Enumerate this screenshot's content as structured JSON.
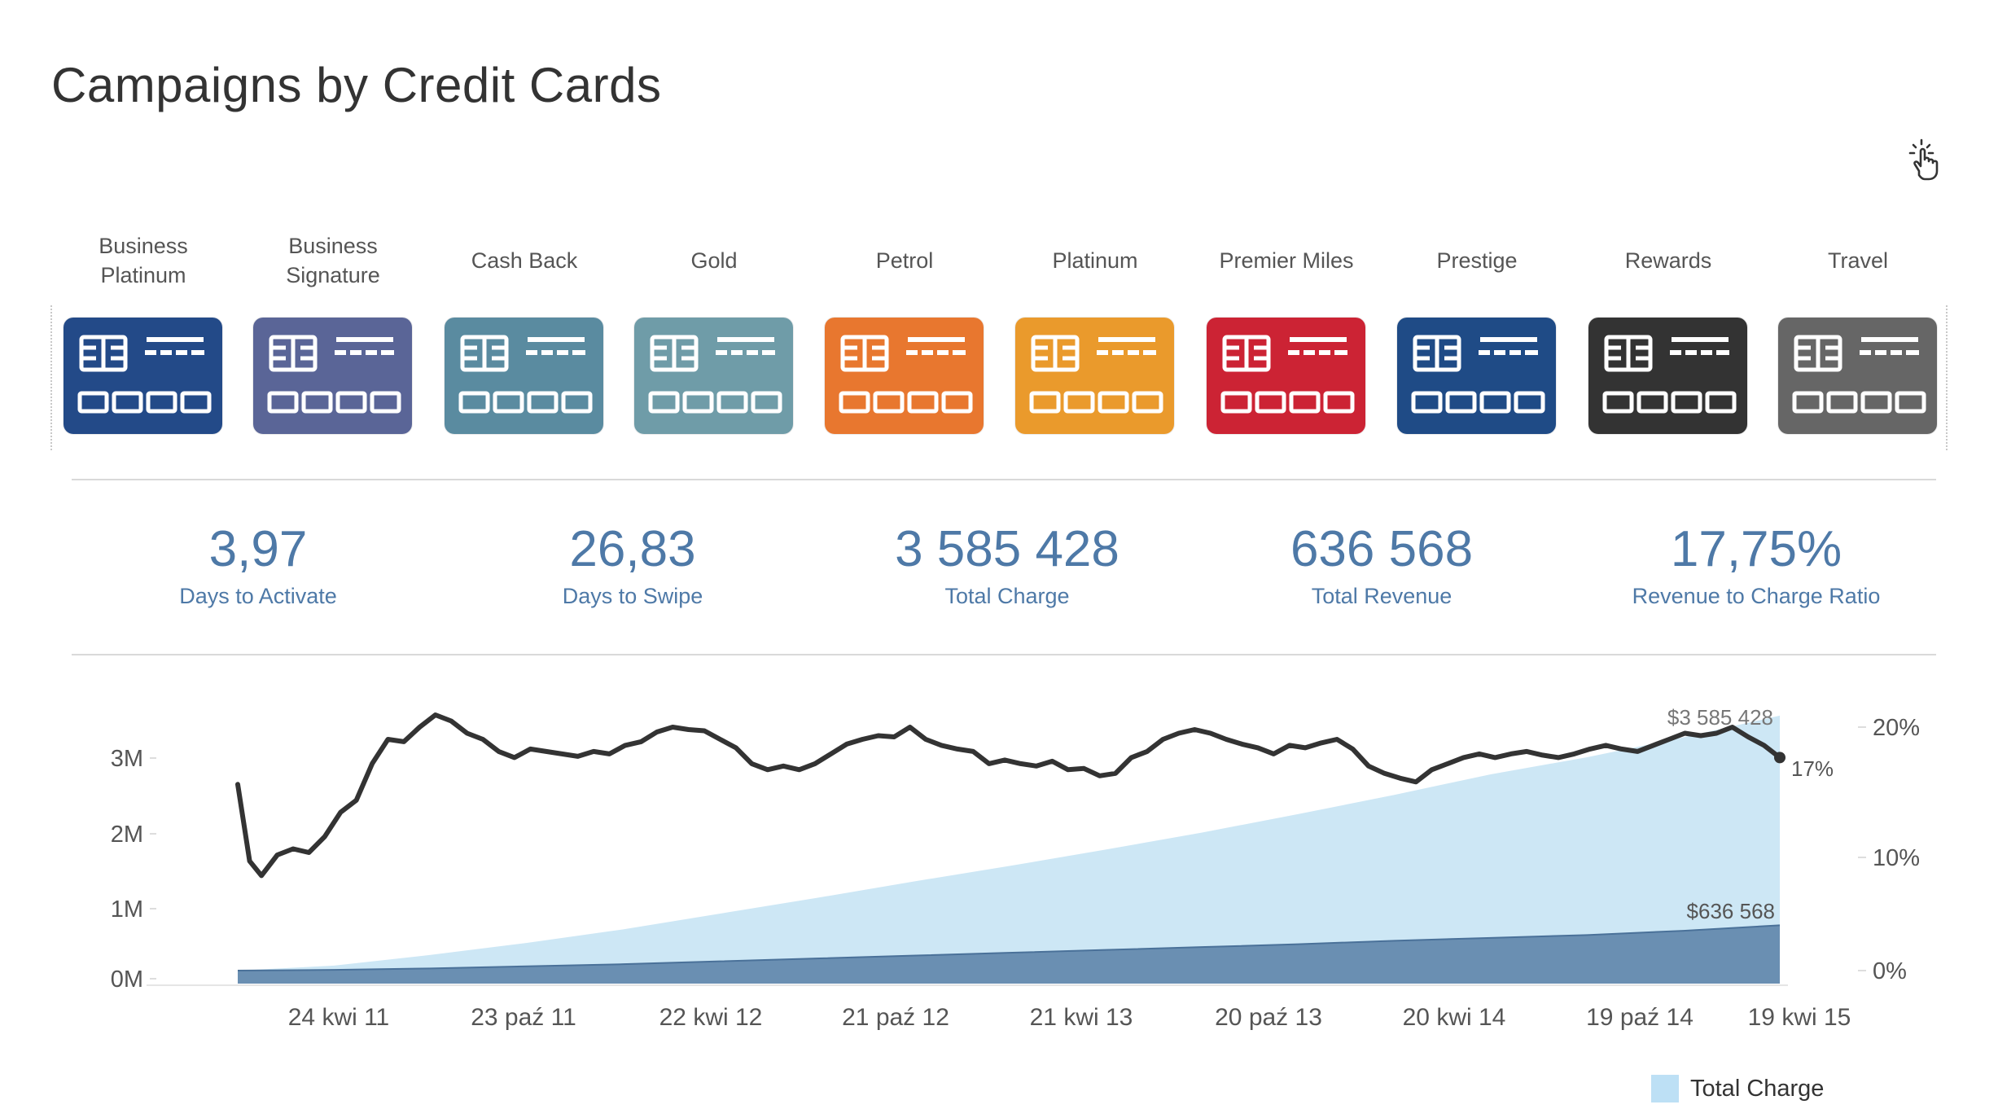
{
  "header": {
    "title": "Campaigns by Credit Cards"
  },
  "toolbar": {
    "touch_icon": "touch-gesture-icon"
  },
  "cards": [
    {
      "label": "Business\nPlatinum",
      "color": "#234a88"
    },
    {
      "label": "Business\nSignature",
      "color": "#5a6597"
    },
    {
      "label": "Cash Back",
      "color": "#5a8ba0"
    },
    {
      "label": "Gold",
      "color": "#6f9ca8"
    },
    {
      "label": "Petrol",
      "color": "#e8772f"
    },
    {
      "label": "Platinum",
      "color": "#ea9a2c"
    },
    {
      "label": "Premier Miles",
      "color": "#cc2334"
    },
    {
      "label": "Prestige",
      "color": "#1f4b86"
    },
    {
      "label": "Rewards",
      "color": "#333333"
    },
    {
      "label": "Travel",
      "color": "#666666"
    }
  ],
  "kpis": [
    {
      "value": "3,97",
      "label": "Days to Activate"
    },
    {
      "value": "26,83",
      "label": "Days to Swipe"
    },
    {
      "value": "3 585 428",
      "label": "Total Charge"
    },
    {
      "value": "636 568",
      "label": "Total Revenue"
    },
    {
      "value": "17,75%",
      "label": "Revenue to Charge Ratio"
    }
  ],
  "legend": {
    "label": "Total Charge",
    "color": "#bde0f5"
  },
  "chart_data": {
    "type": "area",
    "x": [
      "24 kwi 11",
      "23 paź 11",
      "22 kwi 12",
      "21 paź 12",
      "21 kwi 13",
      "20 paź 13",
      "20 kwi 14",
      "19 paź 14",
      "19 kwi 15"
    ],
    "y_left_ticks": [
      "0M",
      "1M",
      "2M",
      "3M"
    ],
    "y_left_range": [
      0,
      3500000
    ],
    "y_right_ticks": [
      "0%",
      "10%",
      "20%"
    ],
    "y_right_range": [
      0,
      0.22
    ],
    "series": [
      {
        "name": "Total Charge",
        "type": "area",
        "axis": "left",
        "color": "#cde7f5",
        "points": [
          [
            0,
            0
          ],
          [
            1,
            70000
          ],
          [
            2,
            220000
          ],
          [
            3,
            390000
          ],
          [
            4,
            580000
          ],
          [
            5,
            800000
          ],
          [
            6,
            1020000
          ],
          [
            7,
            1250000
          ],
          [
            8,
            1470000
          ],
          [
            9,
            1700000
          ],
          [
            10,
            1940000
          ],
          [
            11,
            2200000
          ],
          [
            12,
            2470000
          ],
          [
            13,
            2760000
          ],
          [
            14,
            3000000
          ],
          [
            15,
            3280000
          ],
          [
            16,
            3585428
          ]
        ],
        "end_label": "$3 585 428"
      },
      {
        "type": "area",
        "axis": "left",
        "color": "#6a8fb2",
        "points": [
          [
            0,
            0
          ],
          [
            1,
            10000
          ],
          [
            2,
            30000
          ],
          [
            3,
            60000
          ],
          [
            4,
            90000
          ],
          [
            5,
            130000
          ],
          [
            6,
            170000
          ],
          [
            7,
            210000
          ],
          [
            8,
            250000
          ],
          [
            9,
            290000
          ],
          [
            10,
            330000
          ],
          [
            11,
            370000
          ],
          [
            12,
            420000
          ],
          [
            13,
            460000
          ],
          [
            14,
            500000
          ],
          [
            15,
            560000
          ],
          [
            16,
            636568
          ]
        ],
        "end_label": "$636 568"
      },
      {
        "type": "line",
        "axis": "right",
        "color": "#333333",
        "points": [
          [
            0,
            0.153
          ],
          [
            0.15,
            0.09
          ],
          [
            0.3,
            0.078
          ],
          [
            0.5,
            0.095
          ],
          [
            0.7,
            0.1
          ],
          [
            0.9,
            0.097
          ],
          [
            1.1,
            0.11
          ],
          [
            1.3,
            0.13
          ],
          [
            1.5,
            0.14
          ],
          [
            1.7,
            0.17
          ],
          [
            1.9,
            0.19
          ],
          [
            2.1,
            0.188
          ],
          [
            2.3,
            0.2
          ],
          [
            2.5,
            0.21
          ],
          [
            2.7,
            0.205
          ],
          [
            2.9,
            0.195
          ],
          [
            3.1,
            0.19
          ],
          [
            3.3,
            0.18
          ],
          [
            3.5,
            0.175
          ],
          [
            3.7,
            0.182
          ],
          [
            3.9,
            0.18
          ],
          [
            4.1,
            0.178
          ],
          [
            4.3,
            0.176
          ],
          [
            4.5,
            0.18
          ],
          [
            4.7,
            0.178
          ],
          [
            4.9,
            0.185
          ],
          [
            5.1,
            0.188
          ],
          [
            5.3,
            0.196
          ],
          [
            5.5,
            0.2
          ],
          [
            5.7,
            0.198
          ],
          [
            5.9,
            0.197
          ],
          [
            6.1,
            0.19
          ],
          [
            6.3,
            0.183
          ],
          [
            6.5,
            0.17
          ],
          [
            6.7,
            0.165
          ],
          [
            6.9,
            0.168
          ],
          [
            7.1,
            0.165
          ],
          [
            7.3,
            0.17
          ],
          [
            7.5,
            0.178
          ],
          [
            7.7,
            0.186
          ],
          [
            7.9,
            0.19
          ],
          [
            8.1,
            0.193
          ],
          [
            8.3,
            0.192
          ],
          [
            8.5,
            0.2
          ],
          [
            8.7,
            0.19
          ],
          [
            8.9,
            0.185
          ],
          [
            9.1,
            0.182
          ],
          [
            9.3,
            0.18
          ],
          [
            9.5,
            0.17
          ],
          [
            9.7,
            0.173
          ],
          [
            9.9,
            0.17
          ],
          [
            10.1,
            0.168
          ],
          [
            10.3,
            0.172
          ],
          [
            10.5,
            0.165
          ],
          [
            10.7,
            0.166
          ],
          [
            10.9,
            0.16
          ],
          [
            11.1,
            0.162
          ],
          [
            11.3,
            0.175
          ],
          [
            11.5,
            0.18
          ],
          [
            11.7,
            0.19
          ],
          [
            11.9,
            0.195
          ],
          [
            12.1,
            0.198
          ],
          [
            12.3,
            0.195
          ],
          [
            12.5,
            0.19
          ],
          [
            12.7,
            0.186
          ],
          [
            12.9,
            0.183
          ],
          [
            13.1,
            0.178
          ],
          [
            13.3,
            0.185
          ],
          [
            13.5,
            0.183
          ],
          [
            13.7,
            0.187
          ],
          [
            13.9,
            0.19
          ],
          [
            14.1,
            0.182
          ],
          [
            14.3,
            0.168
          ],
          [
            14.5,
            0.162
          ],
          [
            14.7,
            0.158
          ],
          [
            14.9,
            0.155
          ],
          [
            15.1,
            0.165
          ],
          [
            15.3,
            0.17
          ],
          [
            15.5,
            0.175
          ],
          [
            15.7,
            0.178
          ],
          [
            15.9,
            0.175
          ],
          [
            16.1,
            0.178
          ],
          [
            16.3,
            0.18
          ],
          [
            16.5,
            0.177
          ],
          [
            16.7,
            0.175
          ],
          [
            16.9,
            0.178
          ],
          [
            17.1,
            0.182
          ],
          [
            17.3,
            0.185
          ],
          [
            17.5,
            0.182
          ],
          [
            17.7,
            0.18
          ],
          [
            17.9,
            0.185
          ],
          [
            18.1,
            0.19
          ],
          [
            18.3,
            0.195
          ],
          [
            18.5,
            0.193
          ],
          [
            18.7,
            0.195
          ],
          [
            18.9,
            0.2
          ],
          [
            19.1,
            0.192
          ],
          [
            19.3,
            0.185
          ],
          [
            19.5,
            0.175
          ]
        ],
        "end_label": "17%"
      }
    ],
    "grid": false,
    "legend_position": "bottom-right"
  }
}
